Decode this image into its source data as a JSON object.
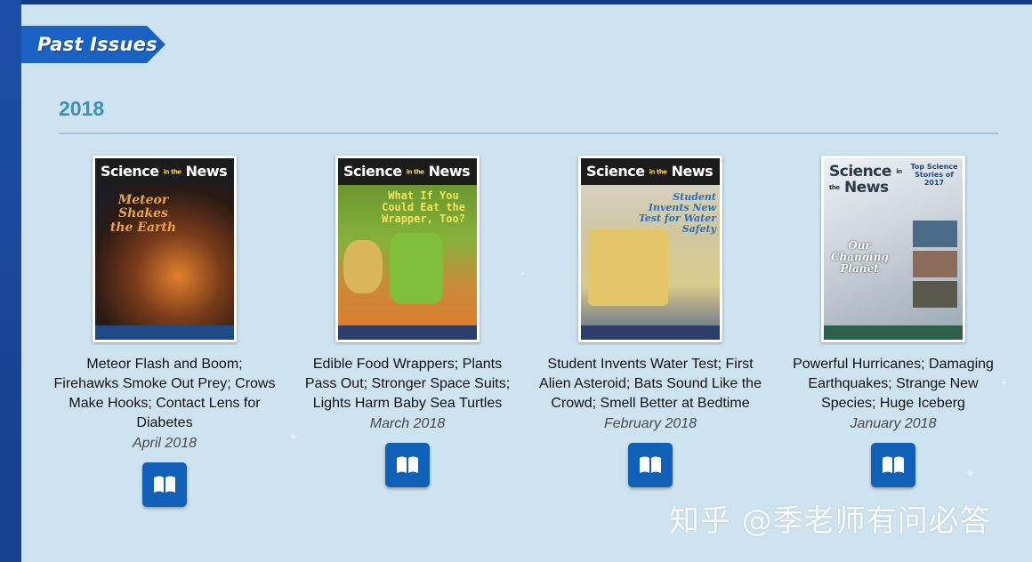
{
  "section": {
    "banner_label": "Past Issues"
  },
  "year_heading": "2018",
  "issues": [
    {
      "title": "Meteor Flash and Boom; Firehawks Smoke Out Prey; Crows Make Hooks; Contact Lens for Diabetes",
      "date": "April 2018",
      "cover": {
        "masthead": "Science",
        "masthead_small": "in the",
        "masthead_end": "News",
        "headline": "Meteor Shakes the Earth",
        "bg": "#3a2a22",
        "accent": "#d9762b"
      }
    },
    {
      "title": "Edible Food Wrappers; Plants Pass Out; Stronger Space Suits; Lights Harm Baby Sea Turtles",
      "date": "March 2018",
      "cover": {
        "masthead": "Science",
        "masthead_small": "in the",
        "masthead_end": "News",
        "headline": "What If You Could Eat the Wrapper, Too?",
        "bg": "#6a8f2a",
        "accent": "#f0e04a"
      }
    },
    {
      "title": "Student Invents Water Test; First Alien Asteroid; Bats Sound Like the Crowd; Smell Better at Bedtime",
      "date": "February 2018",
      "cover": {
        "masthead": "Science",
        "masthead_small": "in the",
        "masthead_end": "News",
        "headline": "Student Invents New Test for Water Safety",
        "bg": "#c9b98a",
        "accent": "#2e6fb8"
      }
    },
    {
      "title": "Powerful Hurricanes; Damaging Earthquakes; Strange New Species; Huge Iceberg",
      "date": "January 2018",
      "cover": {
        "masthead": "Science",
        "masthead_small": "in the",
        "masthead_end": "News",
        "headline": "Our Changing Planet",
        "bg": "#dfe5ea",
        "accent": "#3a6ea8",
        "badge": "Top Science Stories of 2017"
      }
    }
  ],
  "read_button_icon": "open-book-icon",
  "watermark": "知乎 @季老师有问必答"
}
